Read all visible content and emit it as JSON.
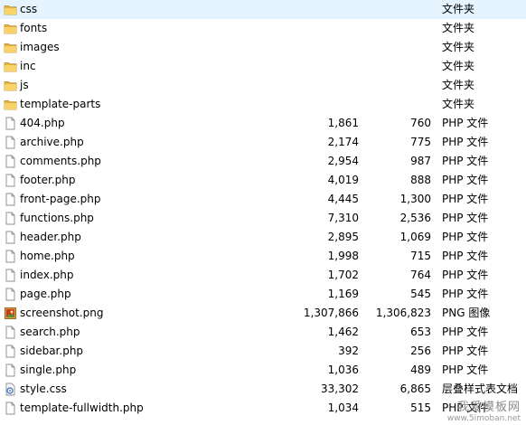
{
  "files": [
    {
      "name": "css",
      "icon": "folder-icon",
      "size": "",
      "packed": "",
      "type": "文件夹"
    },
    {
      "name": "fonts",
      "icon": "folder-icon",
      "size": "",
      "packed": "",
      "type": "文件夹"
    },
    {
      "name": "images",
      "icon": "folder-icon",
      "size": "",
      "packed": "",
      "type": "文件夹"
    },
    {
      "name": "inc",
      "icon": "folder-icon",
      "size": "",
      "packed": "",
      "type": "文件夹"
    },
    {
      "name": "js",
      "icon": "folder-icon",
      "size": "",
      "packed": "",
      "type": "文件夹"
    },
    {
      "name": "template-parts",
      "icon": "folder-icon",
      "size": "",
      "packed": "",
      "type": "文件夹"
    },
    {
      "name": "404.php",
      "icon": "file-icon",
      "size": "1,861",
      "packed": "760",
      "type": "PHP 文件"
    },
    {
      "name": "archive.php",
      "icon": "file-icon",
      "size": "2,174",
      "packed": "775",
      "type": "PHP 文件"
    },
    {
      "name": "comments.php",
      "icon": "file-icon",
      "size": "2,954",
      "packed": "987",
      "type": "PHP 文件"
    },
    {
      "name": "footer.php",
      "icon": "file-icon",
      "size": "4,019",
      "packed": "888",
      "type": "PHP 文件"
    },
    {
      "name": "front-page.php",
      "icon": "file-icon",
      "size": "4,445",
      "packed": "1,300",
      "type": "PHP 文件"
    },
    {
      "name": "functions.php",
      "icon": "file-icon",
      "size": "7,310",
      "packed": "2,536",
      "type": "PHP 文件"
    },
    {
      "name": "header.php",
      "icon": "file-icon",
      "size": "2,895",
      "packed": "1,069",
      "type": "PHP 文件"
    },
    {
      "name": "home.php",
      "icon": "file-icon",
      "size": "1,998",
      "packed": "715",
      "type": "PHP 文件"
    },
    {
      "name": "index.php",
      "icon": "file-icon",
      "size": "1,702",
      "packed": "764",
      "type": "PHP 文件"
    },
    {
      "name": "page.php",
      "icon": "file-icon",
      "size": "1,169",
      "packed": "545",
      "type": "PHP 文件"
    },
    {
      "name": "screenshot.png",
      "icon": "image-file-icon",
      "size": "1,307,866",
      "packed": "1,306,823",
      "type": "PNG 图像"
    },
    {
      "name": "search.php",
      "icon": "file-icon",
      "size": "1,462",
      "packed": "653",
      "type": "PHP 文件"
    },
    {
      "name": "sidebar.php",
      "icon": "file-icon",
      "size": "392",
      "packed": "256",
      "type": "PHP 文件"
    },
    {
      "name": "single.php",
      "icon": "file-icon",
      "size": "1,036",
      "packed": "489",
      "type": "PHP 文件"
    },
    {
      "name": "style.css",
      "icon": "css-file-icon",
      "size": "33,302",
      "packed": "6,865",
      "type": "层叠样式表文档"
    },
    {
      "name": "template-fullwidth.php",
      "icon": "file-icon",
      "size": "1,034",
      "packed": "515",
      "type": "PHP 文件"
    }
  ],
  "watermark": {
    "text": "我爱模板网",
    "url": "www.5imoban.net"
  }
}
